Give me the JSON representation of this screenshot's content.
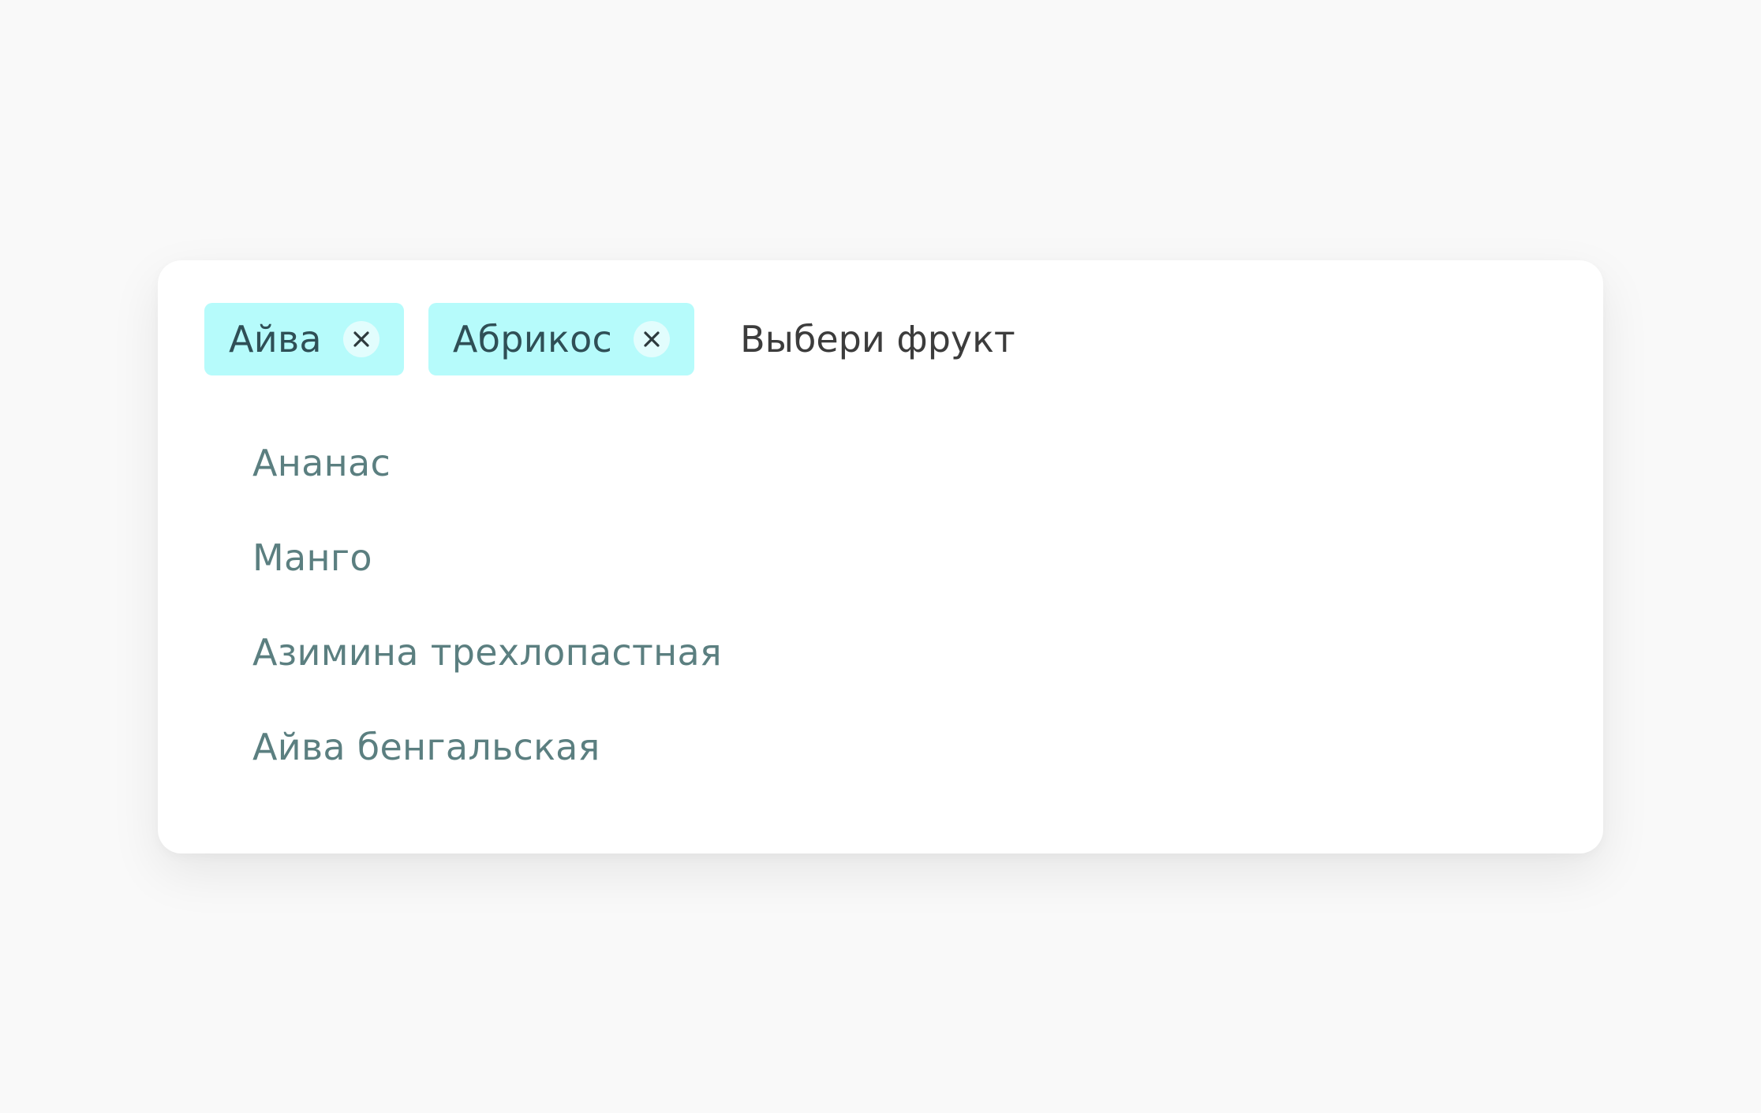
{
  "multiselect": {
    "selected_chips": [
      {
        "label": "Айва",
        "remove_icon": "close-icon"
      },
      {
        "label": "Абрикос",
        "remove_icon": "close-icon"
      }
    ],
    "input": {
      "value": "",
      "placeholder": "Выбери фрукт"
    },
    "options": [
      "Ананас",
      "Манго",
      "Азимина трехлопастная",
      "Айва бенгальская"
    ]
  },
  "colors": {
    "page_background": "#f9f9f9",
    "card_background": "#ffffff",
    "chip_background": "#b6fbfb",
    "chip_text": "#2f4f56",
    "option_text": "#5b7f80",
    "placeholder_text": "#3c3c3c"
  }
}
